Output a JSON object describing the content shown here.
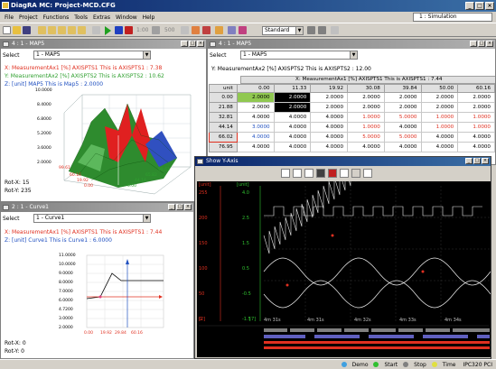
{
  "window": {
    "title": "DiagRA MC: Project-MCD.CFG",
    "simulation": "1 : Simulation"
  },
  "menu": [
    "File",
    "Project",
    "Functions",
    "Tools",
    "Extras",
    "Window",
    "Help"
  ],
  "toolbar": {
    "standard": "Standard",
    "speed": "1:00",
    "speed_value": "500"
  },
  "map_panel": {
    "title": "4 : 1 - MAP5",
    "select_label": "Select",
    "select_value": "1 - MAP5",
    "line_x": "X: MeasurementAx1 [%] AXISPTS1 This is AXISPTS1 : 7.38",
    "line_y": "Y: MeasurementAx2 [%] AXISPTS2 This is AXISPTS2 : 10.62",
    "line_z": "Z: [unit] MAP5 This is Map5 : 2.0000",
    "rot_x": "Rot-X: 15",
    "rot_y": "Rot-Y: 235",
    "z_axis": [
      "10.0000",
      "8.4000",
      "6.8000",
      "5.2000",
      "3.6000",
      "2.0000"
    ],
    "x_axis": [
      "99.61",
      "60.16",
      "19.92",
      "0.00"
    ],
    "y_axis": [
      "0.00",
      "44.14",
      "65.82",
      "99.61"
    ]
  },
  "table_panel": {
    "title": "4 : 1 - MAP5",
    "select_label": "Select",
    "select_value": "1 - MAP5",
    "line_y": "Y: MeasurementAx2 [%] AXISPTS2 This is AXISPTS2 : 12.00",
    "line_x": "X: MeasurementAx1 [%] AXISPTS1 This is AXISPTS1 : 7.44",
    "unit_label": "unit",
    "columns": [
      "0.00",
      "11.33",
      "19.92",
      "30.08",
      "39.84",
      "50.00",
      "60.16"
    ],
    "rows": [
      {
        "label": "0.00",
        "values": [
          "2.0000",
          "2.0000",
          "2.0000",
          "2.0000",
          "2.0000",
          "2.0000",
          "2.0000"
        ]
      },
      {
        "label": "21.88",
        "values": [
          "2.0000",
          "2.0000",
          "2.0000",
          "2.0000",
          "2.0000",
          "2.0000",
          "2.0000"
        ]
      },
      {
        "label": "32.81",
        "values": [
          "4.0000",
          "4.0000",
          "4.0000",
          "1.0000",
          "5.0000",
          "1.0000",
          "1.0000"
        ]
      },
      {
        "label": "44.14",
        "values": [
          "3.0000",
          "4.0000",
          "4.0000",
          "1.0000",
          "4.0000",
          "1.0000",
          "1.0000"
        ]
      },
      {
        "label": "66.02",
        "values": [
          "4.0000",
          "4.0000",
          "4.0000",
          "5.0000",
          "5.0000",
          "4.0000",
          "4.0000"
        ]
      },
      {
        "label": "76.95",
        "values": [
          "4.0000",
          "4.0000",
          "4.0000",
          "4.0000",
          "4.0000",
          "4.0000",
          "4.0000"
        ]
      }
    ]
  },
  "curve_panel": {
    "title": "2 : 1 - Curve1",
    "select_label": "Select",
    "select_value": "1 - Curve1",
    "line_x": "X: MeasurementAx1 [%] AXISPTS1 This is AXISPTS1 : 7.44",
    "line_z": "Z: [unit] Curve1 This is Curve1 : 6.0000",
    "rot_x": "Rot-X: 0",
    "rot_y": "Rot-Y: 0",
    "y_axis": [
      "11.0000",
      "10.0000",
      "9.0000",
      "8.0000",
      "7.0000",
      "6.0000",
      "4.7200",
      "3.0000",
      "2.0000"
    ],
    "x_axis": [
      "0.00",
      "19.92",
      "29.84",
      "60.16"
    ]
  },
  "yaxis_panel": {
    "title": "Show Y-Axis",
    "unit_left": "[unit]",
    "unit_mid": "[unit]",
    "left_ticks": [
      "255",
      "200",
      "150",
      "100",
      "50",
      "0"
    ],
    "mid_ticks": [
      "4.0",
      "2.5",
      "1.5",
      "0.5",
      "-0.5",
      "-1.5"
    ],
    "bottom_left": "[2]",
    "bottom_mid": "[7]",
    "time_labels": [
      "4m 31s",
      "4m 31s",
      "4m 32s",
      "4m 33s",
      "4m 34s"
    ]
  },
  "status_bar": {
    "demo": "Demo",
    "start": "Start",
    "stop": "Stop",
    "time": "Time",
    "device": "IPC320 PCI"
  },
  "colors": {
    "title_active": "#0a246a",
    "red": "#e03020",
    "green": "#30a030",
    "blue": "#2050c0",
    "scope_bg": "#000000"
  }
}
